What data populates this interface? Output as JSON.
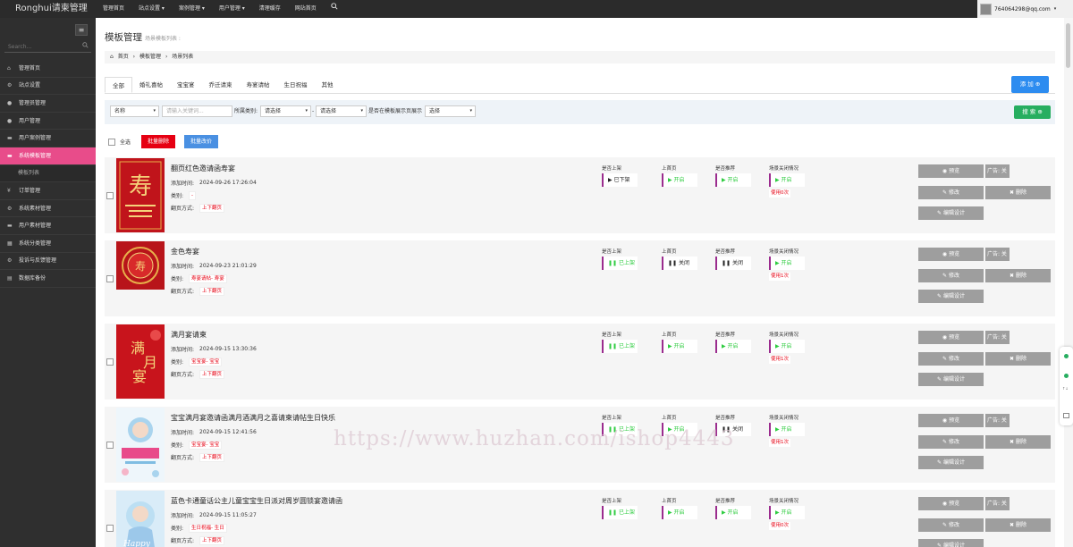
{
  "app": {
    "brand": "Ronghui请柬管理"
  },
  "topnav": {
    "items": [
      "管理首页",
      "站点设置 ▾",
      "案例管理 ▾",
      "用户管理 ▾",
      "清理缓存",
      "网站首页"
    ],
    "user": "764064298@qq.com"
  },
  "sidebar": {
    "search_placeholder": "Search...",
    "items": [
      {
        "label": "管理首页",
        "icon": "home-icon"
      },
      {
        "label": "站点设置",
        "icon": "settings-icon"
      },
      {
        "label": "管理员管理",
        "icon": "user-icon"
      },
      {
        "label": "用户管理",
        "icon": "users-icon"
      },
      {
        "label": "用户案例管理",
        "icon": "folder-icon"
      },
      {
        "label": "系统模板管理",
        "icon": "template-icon",
        "active": true
      },
      {
        "label": "模板列表",
        "icon": "",
        "sub": true
      },
      {
        "label": "订单管理",
        "icon": "yen-icon"
      },
      {
        "label": "系统素材管理",
        "icon": "settings-icon"
      },
      {
        "label": "用户素材管理",
        "icon": "folder-icon"
      },
      {
        "label": "系统分类管理",
        "icon": "category-icon"
      },
      {
        "label": "投诉与反馈管理",
        "icon": "settings-icon"
      },
      {
        "label": "数据库备份",
        "icon": "database-icon"
      }
    ]
  },
  "page": {
    "title": "模板管理",
    "subtitle": "场景模板列表 :",
    "breadcrumb": [
      "首页",
      "模板管理",
      "场景列表"
    ],
    "tabs": [
      "全部",
      "婚礼喜帖",
      "宝宝宴",
      "乔迁请柬",
      "寿宴请帖",
      "生日祝福",
      "其他"
    ],
    "add_label": "添 加"
  },
  "filter": {
    "name_select": "名称",
    "keyword_placeholder": "请输入关键词...",
    "category_label": "所属类别:",
    "category_select1": "请选择",
    "dash": "-",
    "category_select2": "请选择",
    "show_label": "是否在模板展示页展示",
    "show_select": "选择",
    "search_label": "搜 索"
  },
  "bulk": {
    "select_all": "全选",
    "delete_label": "批量删除",
    "price_label": "批量改价"
  },
  "row_labels": {
    "added": "添加时间:",
    "category": "类别:",
    "flip": "翻页方式:",
    "s1": "是否上架",
    "s2": "上首页",
    "s3": "是否推荐",
    "s4": "场景关闭情况",
    "preview": "预览",
    "edit": "修改",
    "delete": "删除",
    "design": "编辑设计",
    "ad": "广告: 关"
  },
  "rows": [
    {
      "title": "翻页红色邀请函寿宴",
      "time": "2024-09-26 17:26:04",
      "category": "-",
      "flip": "上下翻页",
      "listed": "已下架",
      "home": "开启",
      "recommend": "开启",
      "close": "开启",
      "usage": "使用0次"
    },
    {
      "title": "金色寿宴",
      "time": "2024-09-23 21:01:29",
      "category": "寿宴请帖- 寿宴",
      "flip": "上下翻页",
      "listed": "已上架",
      "home": "关闭",
      "recommend": "关闭",
      "close": "开启",
      "usage": "使用1次"
    },
    {
      "title": "满月宴请柬",
      "time": "2024-09-15 13:30:36",
      "category": "宝宝宴- 宝宝",
      "flip": "上下翻页",
      "listed": "已上架",
      "home": "开启",
      "recommend": "开启",
      "close": "开启",
      "usage": "使用1次"
    },
    {
      "title": "宝宝满月宴邀请函满月酒满月之喜请柬请帖生日快乐",
      "time": "2024-09-15 12:41:56",
      "category": "宝宝宴- 宝宝",
      "flip": "上下翻页",
      "listed": "已上架",
      "home": "开启",
      "recommend": "关闭",
      "close": "开启",
      "usage": "使用1次"
    },
    {
      "title": "蓝色卡通童话公主儿童宝宝生日派对周岁圆锁宴邀请函",
      "time": "2024-09-15 11:05:27",
      "category": "生日祝福- 生日",
      "flip": "上下翻页",
      "listed": "已上架",
      "home": "开启",
      "recommend": "开启",
      "close": "开启",
      "usage": "使用0次"
    }
  ],
  "watermark": "https://www.huzhan.com/ishop4443",
  "colors": {
    "accent_pink": "#e84c8a",
    "on_green": "#2ecc40",
    "danger_red": "#e60012",
    "primary_blue": "#2d8cf0",
    "search_green": "#27ae60"
  }
}
